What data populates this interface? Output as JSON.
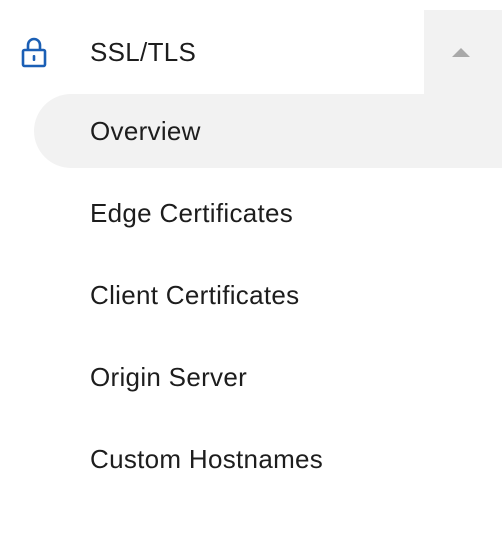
{
  "section": {
    "title": "SSL/TLS",
    "icon": "lock-icon",
    "expanded": true,
    "accent_color": "#1b5fb5"
  },
  "items": [
    {
      "label": "Overview",
      "active": true
    },
    {
      "label": "Edge Certificates",
      "active": false
    },
    {
      "label": "Client Certificates",
      "active": false
    },
    {
      "label": "Origin Server",
      "active": false
    },
    {
      "label": "Custom Hostnames",
      "active": false
    }
  ]
}
